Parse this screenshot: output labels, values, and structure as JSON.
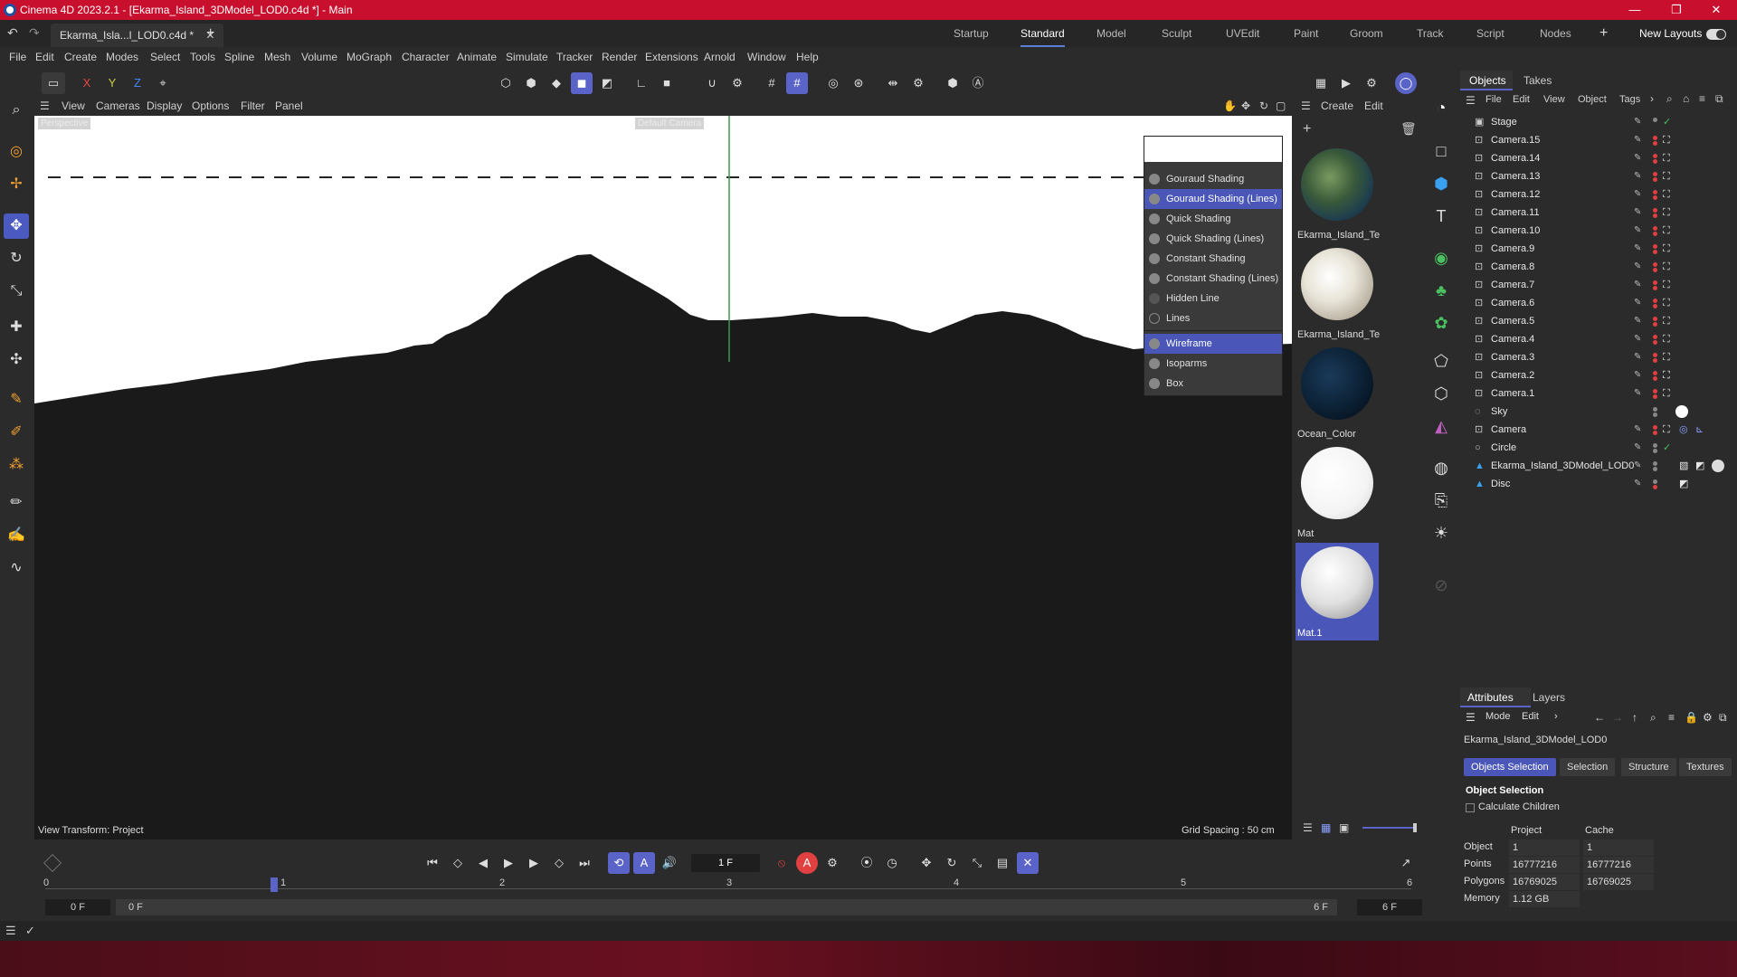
{
  "titlebar": {
    "title": "Cinema 4D 2023.2.1 - [Ekarma_Island_3DModel_LOD0.c4d *] - Main"
  },
  "doc_tab": {
    "label": "Ekarma_Isla...l_LOD0.c4d *"
  },
  "layouts": [
    "Startup",
    "Standard",
    "Model",
    "Sculpt",
    "UVEdit",
    "Paint",
    "Groom",
    "Track",
    "Script",
    "Nodes"
  ],
  "layouts_active": "Standard",
  "new_layouts": "New Layouts",
  "menu": [
    "File",
    "Edit",
    "Create",
    "Modes",
    "Select",
    "Tools",
    "Spline",
    "Mesh",
    "Volume",
    "MoGraph",
    "Character",
    "Animate",
    "Simulate",
    "Tracker",
    "Render",
    "Extensions",
    "Arnold",
    "Window",
    "Help"
  ],
  "axes": {
    "x": "X",
    "y": "Y",
    "z": "Z"
  },
  "viewport_menu": [
    "View",
    "Cameras",
    "Display",
    "Options",
    "Filter",
    "Panel"
  ],
  "viewport": {
    "view_transform": "View Transform: Project",
    "grid_spacing": "Grid Spacing : 50 cm",
    "camera_label": "Perspective",
    "default_camera_label": "Default Camera"
  },
  "shading_menu": [
    {
      "label": "Gouraud Shading",
      "selected": false
    },
    {
      "label": "Gouraud Shading (Lines)",
      "selected": true
    },
    {
      "label": "Quick Shading",
      "selected": false
    },
    {
      "label": "Quick Shading (Lines)",
      "selected": false
    },
    {
      "label": "Constant Shading",
      "selected": false
    },
    {
      "label": "Constant Shading (Lines)",
      "selected": false
    },
    {
      "label": "Hidden Line",
      "selected": false
    },
    {
      "label": "Lines",
      "selected": false
    },
    {
      "label": "Wireframe",
      "selected": true
    },
    {
      "label": "Isoparms",
      "selected": false
    },
    {
      "label": "Box",
      "selected": false
    }
  ],
  "material_menu": {
    "create": "Create",
    "edit": "Edit"
  },
  "materials": [
    {
      "name": "Ekarma_Island_Te"
    },
    {
      "name": "Ekarma_Island_Te"
    },
    {
      "name": "Ocean_Color"
    },
    {
      "name": "Mat"
    },
    {
      "name": "Mat.1"
    }
  ],
  "objects_panel": {
    "tabs": [
      "Objects",
      "Takes"
    ],
    "menu": [
      "File",
      "Edit",
      "View",
      "Object",
      "Tags"
    ],
    "items": [
      "Stage",
      "Camera.15",
      "Camera.14",
      "Camera.13",
      "Camera.12",
      "Camera.11",
      "Camera.10",
      "Camera.9",
      "Camera.8",
      "Camera.7",
      "Camera.6",
      "Camera.5",
      "Camera.4",
      "Camera.3",
      "Camera.2",
      "Camera.1",
      "Sky",
      "Camera",
      "Circle",
      "Ekarma_Island_3DModel_LOD0",
      "Disc"
    ]
  },
  "attributes": {
    "tabs": [
      "Attributes",
      "Layers"
    ],
    "menu": [
      "Mode",
      "Edit"
    ],
    "object_name": "Ekarma_Island_3DModel_LOD0",
    "sub_tabs": [
      "Objects Selection",
      "Selection",
      "Structure",
      "Textures"
    ],
    "section": "Object Selection",
    "calc_children": "Calculate Children",
    "col_project": "Project",
    "col_cache": "Cache",
    "rows": [
      {
        "label": "Object",
        "project": "1",
        "cache": "1"
      },
      {
        "label": "Points",
        "project": "16777216",
        "cache": "16777216"
      },
      {
        "label": "Polygons",
        "project": "16769025",
        "cache": "16769025"
      },
      {
        "label": "Memory",
        "project": "1.12 GB",
        "cache": ""
      }
    ]
  },
  "timeline": {
    "current_frame": "1 F",
    "ticks": [
      "0",
      "1",
      "2",
      "3",
      "4",
      "5",
      "6"
    ],
    "start": "0 F",
    "range_start": "0 F",
    "range_end": "6 F",
    "end": "6 F"
  },
  "colors": {
    "accent": "#5a64c8",
    "titlebar": "#c8102e",
    "selected": "#4a56b8"
  }
}
